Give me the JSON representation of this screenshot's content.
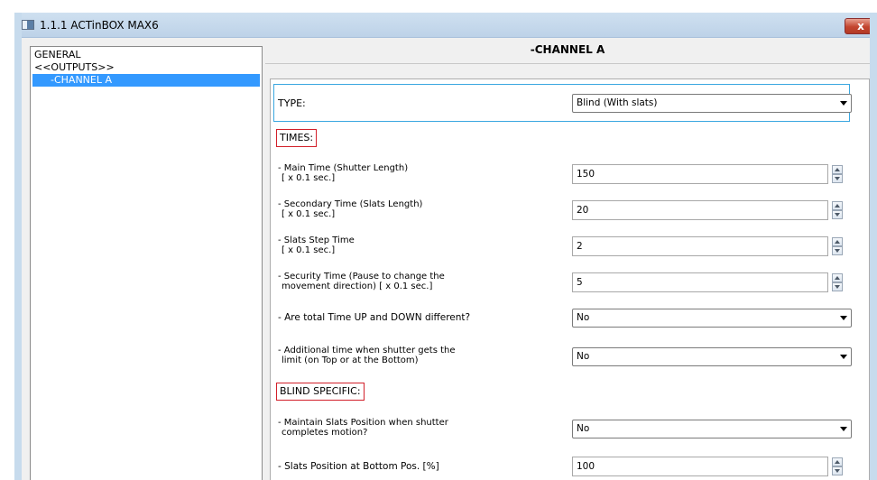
{
  "window": {
    "title": "1.1.1 ACTinBOX MAX6",
    "close_label": "x"
  },
  "tree": {
    "items": [
      {
        "label": "GENERAL",
        "selected": false
      },
      {
        "label": "<<OUTPUTS>>",
        "selected": false
      },
      {
        "label": "-CHANNEL A",
        "selected": true
      }
    ]
  },
  "panel": {
    "title": "-CHANNEL A",
    "type_label": "TYPE:",
    "type_value": "Blind (With slats)",
    "times_header": "TIMES:",
    "main_time_label_1": "- Main Time (Shutter Length)",
    "main_time_label_2": "[ x 0.1 sec.]",
    "main_time_value": "150",
    "secondary_time_label_1": "- Secondary Time (Slats Length)",
    "secondary_time_label_2": "[ x 0.1 sec.]",
    "secondary_time_value": "20",
    "slats_step_label_1": "- Slats Step Time",
    "slats_step_label_2": "[ x 0.1 sec.]",
    "slats_step_value": "2",
    "security_time_label_1": "- Security Time (Pause to change the",
    "security_time_label_2": "movement direction) [ x 0.1 sec.]",
    "security_time_value": "5",
    "total_time_label": "- Are total Time UP and DOWN different?",
    "total_time_value": "No",
    "additional_time_label_1": "- Additional time when shutter gets the",
    "additional_time_label_2": "limit (on Top or at the Bottom)",
    "additional_time_value": "No",
    "blind_header": "BLIND SPECIFIC:",
    "maintain_label_1": "- Maintain Slats Position when shutter",
    "maintain_label_2": "completes motion?",
    "maintain_value": "No",
    "slats_bottom_label": "- Slats Position at Bottom Pos. [%]",
    "slats_bottom_value": "100"
  },
  "colors": {
    "selection": "#3399ff",
    "section_border": "#d2202a",
    "focus_border": "#3aa7e0"
  }
}
